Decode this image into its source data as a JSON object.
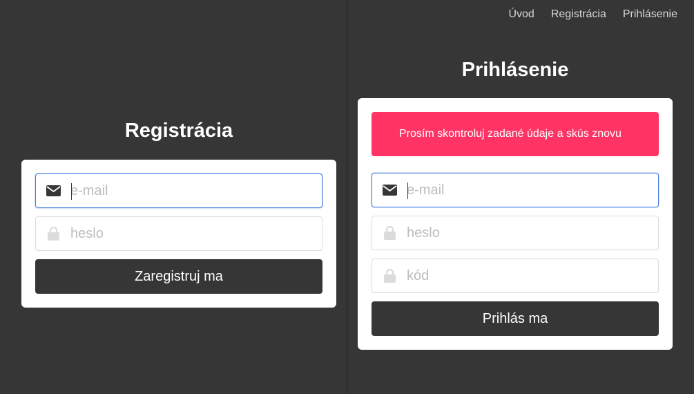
{
  "nav": {
    "items": [
      {
        "label": "Úvod"
      },
      {
        "label": "Registrácia"
      },
      {
        "label": "Prihlásenie"
      }
    ]
  },
  "register": {
    "title": "Registrácia",
    "email_placeholder": "e-mail",
    "password_placeholder": "heslo",
    "submit_label": "Zaregistruj ma"
  },
  "login": {
    "title": "Prihlásenie",
    "error_message": "Prosím skontroluj zadané údaje a skús znovu",
    "email_placeholder": "e-mail",
    "password_placeholder": "heslo",
    "code_placeholder": "kód",
    "submit_label": "Prihlás ma"
  },
  "icons": {
    "email": "envelope-icon",
    "password": "lock-icon",
    "code": "lock-icon"
  },
  "colors": {
    "background": "#363636",
    "button": "#363636",
    "alert": "#ff3465",
    "focus": "#4a7fe0"
  }
}
